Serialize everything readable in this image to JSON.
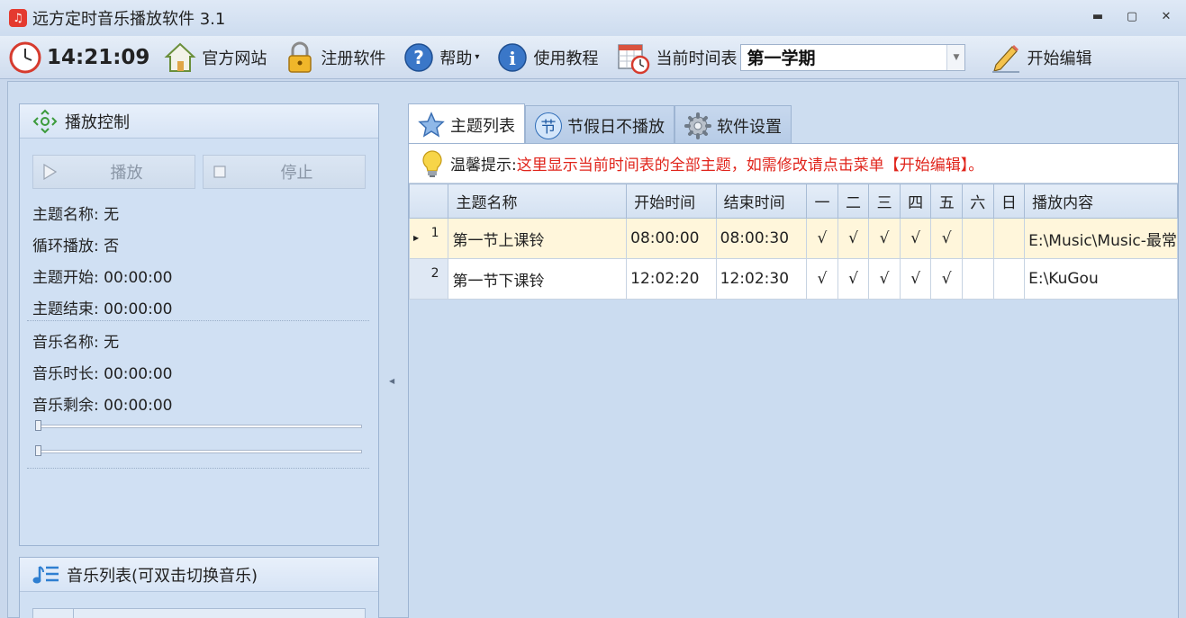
{
  "window": {
    "title": "远方定时音乐播放软件 3.1"
  },
  "toolbar": {
    "clock": "14:21:09",
    "website": "官方网站",
    "register": "注册软件",
    "help": "帮助",
    "tutorial": "使用教程",
    "schedule_label": "当前时间表",
    "schedule_value": "第一学期",
    "edit": "开始编辑"
  },
  "playback": {
    "title": "播放控制",
    "play": "播放",
    "stop": "停止",
    "theme_name": "主题名称: 无",
    "loop": "循环播放: 否",
    "theme_start": "主题开始: 00:00:00",
    "theme_end": "主题结束: 00:00:00",
    "music_name": "音乐名称: 无",
    "music_duration": "音乐时长: 00:00:00",
    "music_remaining": "音乐剩余: 00:00:00",
    "progress": 0,
    "volume": 0
  },
  "music_list": {
    "title": "音乐列表(可双击切换音乐)"
  },
  "tabs": [
    {
      "label": "主题列表"
    },
    {
      "label": "节假日不播放",
      "badge": "节"
    },
    {
      "label": "软件设置"
    }
  ],
  "hint": {
    "label": "温馨提示:",
    "text": "这里显示当前时间表的全部主题，如需修改请点击菜单【开始编辑】。"
  },
  "table": {
    "columns": [
      "主题名称",
      "开始时间",
      "结束时间",
      "一",
      "二",
      "三",
      "四",
      "五",
      "六",
      "日",
      "播放内容"
    ],
    "rows": [
      {
        "num": "1",
        "name": "第一节上课铃",
        "start": "08:00:00",
        "end": "08:00:30",
        "d1": "√",
        "d2": "√",
        "d3": "√",
        "d4": "√",
        "d5": "√",
        "d6": "",
        "d7": "",
        "content": "E:\\Music\\Music-最常"
      },
      {
        "num": "2",
        "name": "第一节下课铃",
        "start": "12:02:20",
        "end": "12:02:30",
        "d1": "√",
        "d2": "√",
        "d3": "√",
        "d4": "√",
        "d5": "√",
        "d6": "",
        "d7": "",
        "content": "E:\\KuGou"
      }
    ]
  },
  "colors": {
    "hint_text": "#e0241b",
    "selected_row": "#fff6db",
    "app_icon": "#e43a2f"
  }
}
